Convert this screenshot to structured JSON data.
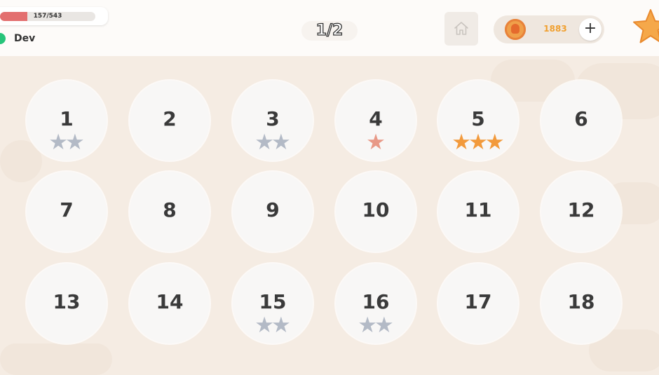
{
  "header": {
    "xp": {
      "current": 157,
      "max": 543,
      "label": "157/543",
      "fill_color": "#e36f6f"
    },
    "username": "Dev",
    "online_color": "#27c47a",
    "page_indicator": "1/2",
    "home_icon": "home-icon",
    "coins": "1883",
    "add_label": "+",
    "star_icon": "star-icon"
  },
  "colors": {
    "gray_star": "#b3bac6",
    "orange_star": "#f29a3c",
    "pink_star": "#e89987"
  },
  "levels": [
    {
      "number": "1",
      "stars": [
        "gray",
        "gray"
      ]
    },
    {
      "number": "2",
      "stars": []
    },
    {
      "number": "3",
      "stars": [
        "gray",
        "gray"
      ]
    },
    {
      "number": "4",
      "stars": [
        "pink"
      ]
    },
    {
      "number": "5",
      "stars": [
        "orange",
        "orange",
        "orange"
      ]
    },
    {
      "number": "6",
      "stars": []
    },
    {
      "number": "7",
      "stars": []
    },
    {
      "number": "8",
      "stars": []
    },
    {
      "number": "9",
      "stars": []
    },
    {
      "number": "10",
      "stars": []
    },
    {
      "number": "11",
      "stars": []
    },
    {
      "number": "12",
      "stars": []
    },
    {
      "number": "13",
      "stars": []
    },
    {
      "number": "14",
      "stars": []
    },
    {
      "number": "15",
      "stars": [
        "gray",
        "gray"
      ]
    },
    {
      "number": "16",
      "stars": [
        "gray",
        "gray"
      ]
    },
    {
      "number": "17",
      "stars": []
    },
    {
      "number": "18",
      "stars": []
    }
  ]
}
